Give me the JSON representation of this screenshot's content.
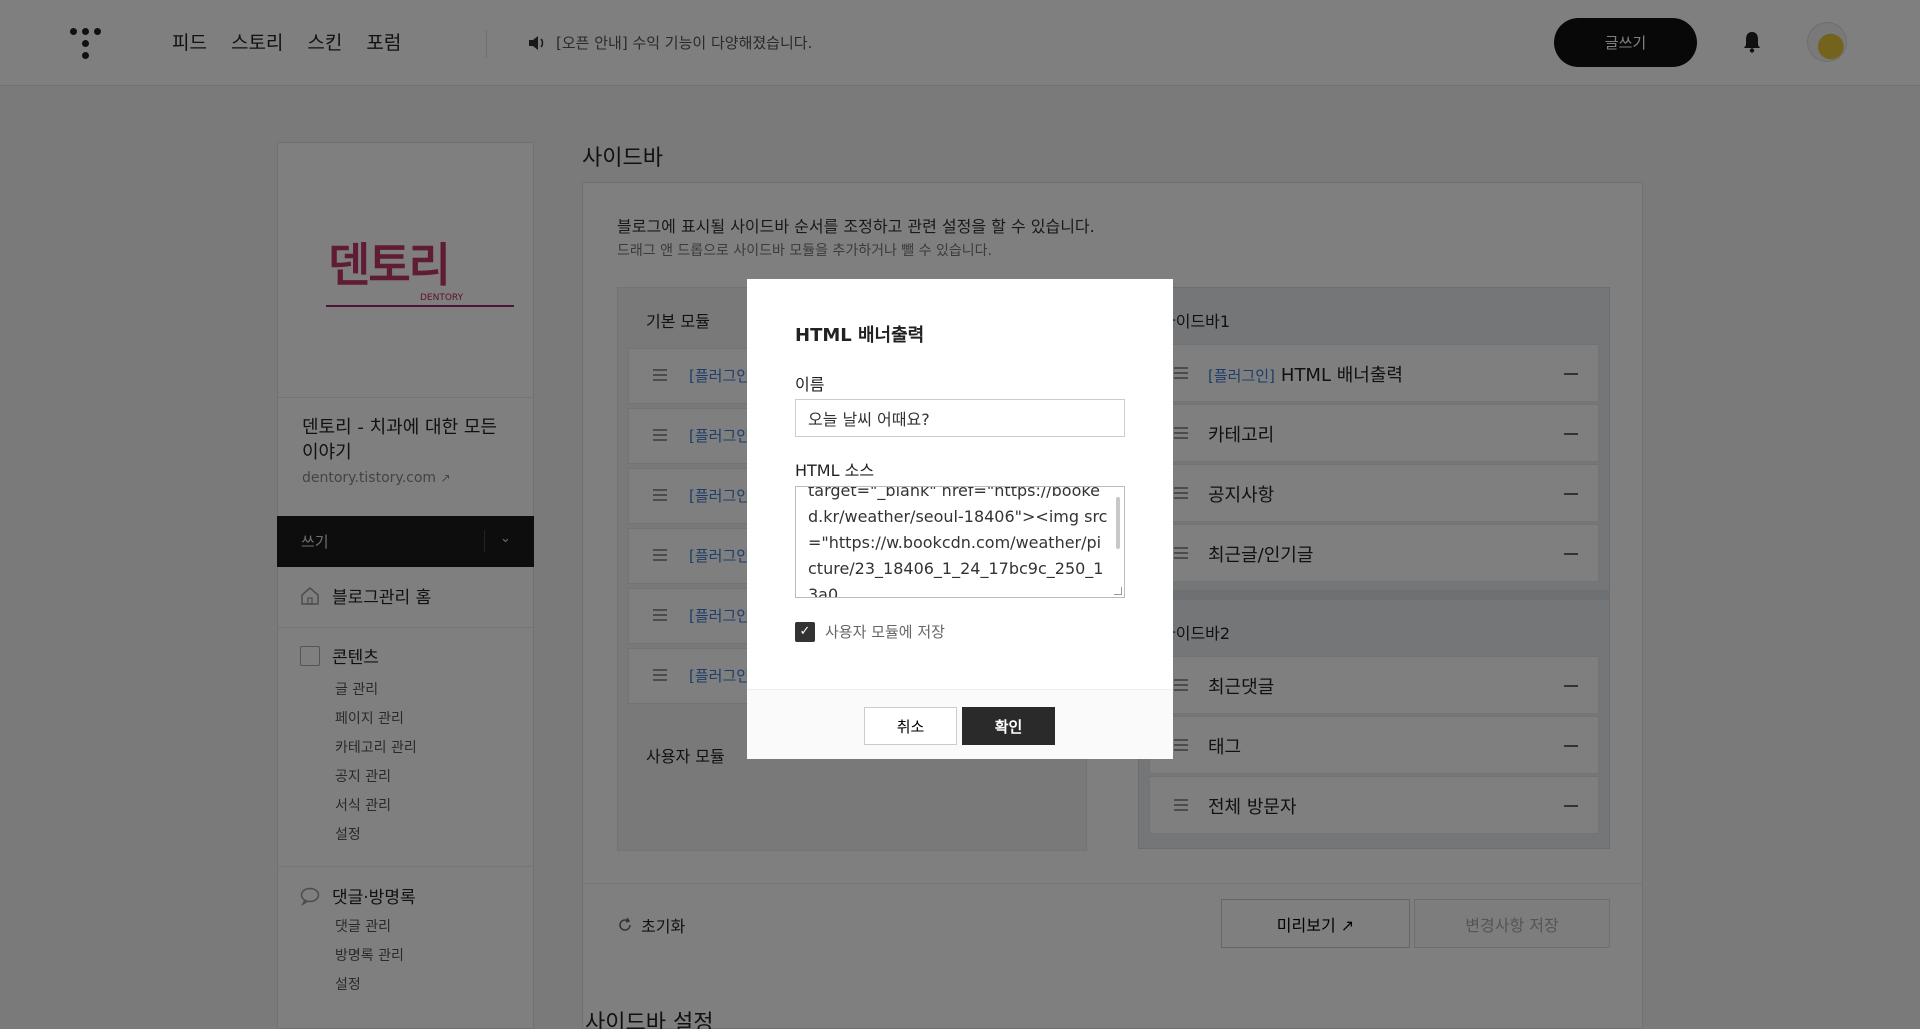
{
  "header": {
    "nav": [
      "피드",
      "스토리",
      "스킨",
      "포럼"
    ],
    "notice": "[오픈 안내] 수익 기능이 다양해졌습니다.",
    "write_button": "글쓰기"
  },
  "blog": {
    "logo_text": "덴토리",
    "logo_sub": "DENTORY",
    "title": "덴토리 - 치과에 대한 모든 이야기",
    "url": "dentory.tistory.com",
    "write_label": "쓰기"
  },
  "menu": {
    "home": "블로그관리 홈",
    "contents": {
      "label": "콘텐츠",
      "items": [
        "글 관리",
        "페이지 관리",
        "카테고리 관리",
        "공지 관리",
        "서식 관리",
        "설정"
      ]
    },
    "comments": {
      "label": "댓글·방명록",
      "items": [
        "댓글 관리",
        "방명록 관리",
        "설정"
      ]
    }
  },
  "main": {
    "title": "사이드바",
    "desc1": "블로그에 표시될 사이드바 순서를 조정하고 관련 설정을 할 수 있습니다.",
    "desc2": "드래그 앤 드롭으로 사이드바 모듈을 추가하거나 뺄 수 있습니다.",
    "basic_modules_head": "기본 모듈",
    "basic_modules": [
      "[플러그인]",
      "[플러그인]",
      "[플러그인]",
      "[플러그인]",
      "[플러그인]",
      "[플러그인]"
    ],
    "user_modules_head": "사용자 모듈",
    "sidebar1": {
      "head": "사이드바1",
      "items": [
        {
          "plugin": "[플러그인]",
          "name": "HTML 배너출력"
        },
        {
          "plugin": "",
          "name": "카테고리"
        },
        {
          "plugin": "",
          "name": "공지사항"
        },
        {
          "plugin": "",
          "name": "최근글/인기글"
        }
      ]
    },
    "sidebar2": {
      "head": "사이드바2",
      "items": [
        "최근댓글",
        "태그",
        "전체 방문자"
      ]
    },
    "reset": "초기화",
    "preview": "미리보기",
    "save": "변경사항 저장",
    "next_section": "사이드바 설정"
  },
  "modal": {
    "title": "HTML 배너출력",
    "name_label": "이름",
    "name_value": "오늘 날씨 어때요?",
    "source_label": "HTML 소스",
    "source_text": "target=\"_blank\" href=\"https://booked.kr/weather/seoul-18406\"><img src=\"https://w.bookcdn.com/weather/picture/23_18406_1_24_17bc9c_250_13a0",
    "save_checkbox_label": "사용자 모듈에 저장",
    "save_checked": true,
    "cancel": "취소",
    "confirm": "확인"
  }
}
